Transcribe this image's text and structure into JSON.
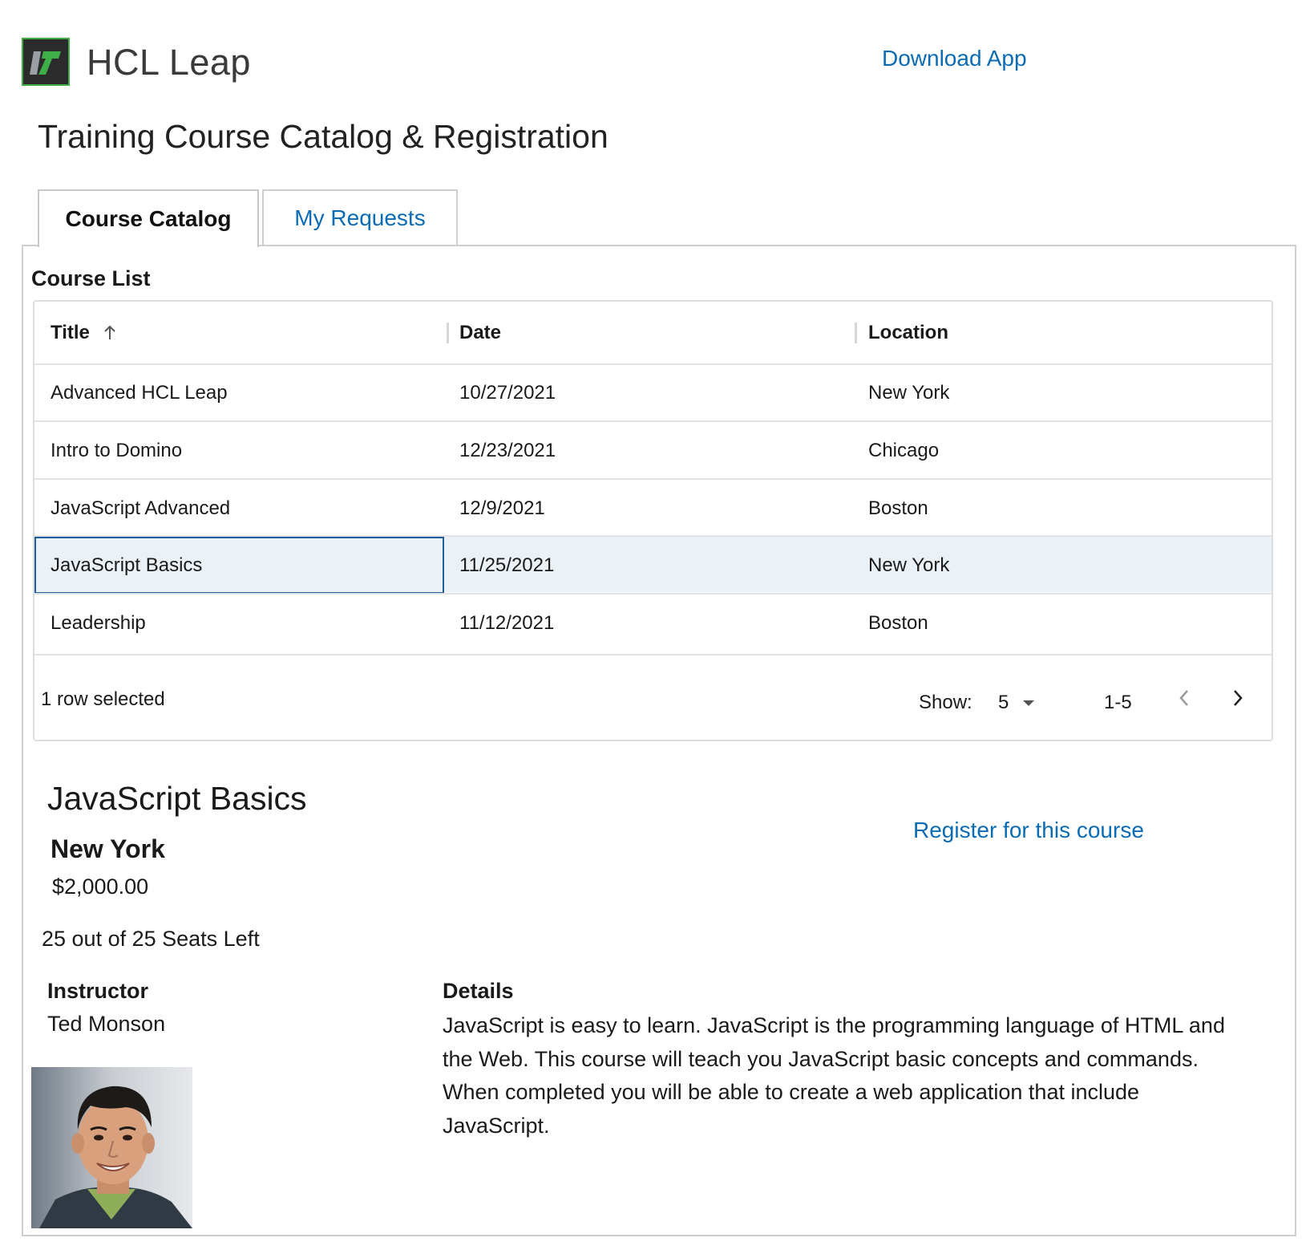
{
  "header": {
    "brand": "HCL Leap",
    "download_link": "Download App"
  },
  "page_title": "Training Course Catalog & Registration",
  "tabs": [
    {
      "label": "Course Catalog",
      "active": true
    },
    {
      "label": "My Requests",
      "active": false
    }
  ],
  "course_list": {
    "label": "Course List",
    "columns": [
      "Title",
      "Date",
      "Location"
    ],
    "sort": {
      "column": "Title",
      "direction": "ascending"
    },
    "rows": [
      {
        "title": "Advanced HCL Leap",
        "date": "10/27/2021",
        "location": "New York",
        "selected": false
      },
      {
        "title": "Intro to Domino",
        "date": "12/23/2021",
        "location": "Chicago",
        "selected": false
      },
      {
        "title": "JavaScript Advanced",
        "date": "12/9/2021",
        "location": "Boston",
        "selected": false
      },
      {
        "title": "JavaScript Basics",
        "date": "11/25/2021",
        "location": "New York",
        "selected": true
      },
      {
        "title": "Leadership",
        "date": "11/12/2021",
        "location": "Boston",
        "selected": false
      }
    ],
    "footer": {
      "selected_text": "1 row selected",
      "show_label": "Show:",
      "show_value": "5",
      "range": "1-5"
    }
  },
  "detail": {
    "title": "JavaScript Basics",
    "location": "New York",
    "price": "$2,000.00",
    "register_link": "Register for this course",
    "seats": "25 out of 25 Seats Left",
    "instructor_label": "Instructor",
    "instructor_name": "Ted Monson",
    "details_label": "Details",
    "details_text": "JavaScript is easy to learn. JavaScript is the programming language of HTML and the Web. This course will teach you JavaScript basic concepts and commands. When completed you will be able to create a web application that include JavaScript."
  },
  "colors": {
    "link": "#0b6bb5",
    "selected_row": "#eaf1f7",
    "focus_border": "#1f5f9f"
  }
}
